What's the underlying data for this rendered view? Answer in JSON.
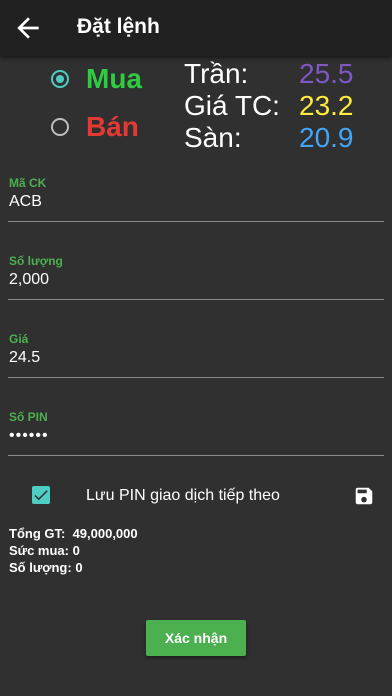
{
  "header": {
    "title": "Đặt lệnh",
    "back_icon": "arrow-back-icon"
  },
  "order_side": {
    "buy_label": "Mua",
    "sell_label": "Bán",
    "selected": "buy",
    "buy_color": "#2ecc40",
    "sell_color": "#e53935"
  },
  "prices": {
    "ceiling_label": "Trần:",
    "ceiling_value": "25.5",
    "ceiling_color": "#7e57c2",
    "reference_label": "Giá TC:",
    "reference_value": "23.2",
    "reference_color": "#ffeb3b",
    "floor_label": "Sàn:",
    "floor_value": "20.9",
    "floor_color": "#42a5f5"
  },
  "form": {
    "symbol_label": "Mã CK",
    "symbol_value": "ACB",
    "quantity_label": "Số lượng",
    "quantity_value": "2,000",
    "price_label": "Giá",
    "price_value": "24.5",
    "pin_label": "Số PIN",
    "pin_value": "••••••"
  },
  "save_pin": {
    "checked": true,
    "label": "Lưu PIN giao dịch tiếp theo",
    "icon": "save-icon"
  },
  "summary": {
    "total_label": "Tổng GT:",
    "total_value": "49,000,000",
    "buying_power_label": "Sức mua:",
    "buying_power_value": "0",
    "quantity_label": "Số lượng:",
    "quantity_value": "0"
  },
  "confirm_button": "Xác nhận",
  "accent_color": "#4caf50",
  "checkbox_color": "#4ecdc4"
}
